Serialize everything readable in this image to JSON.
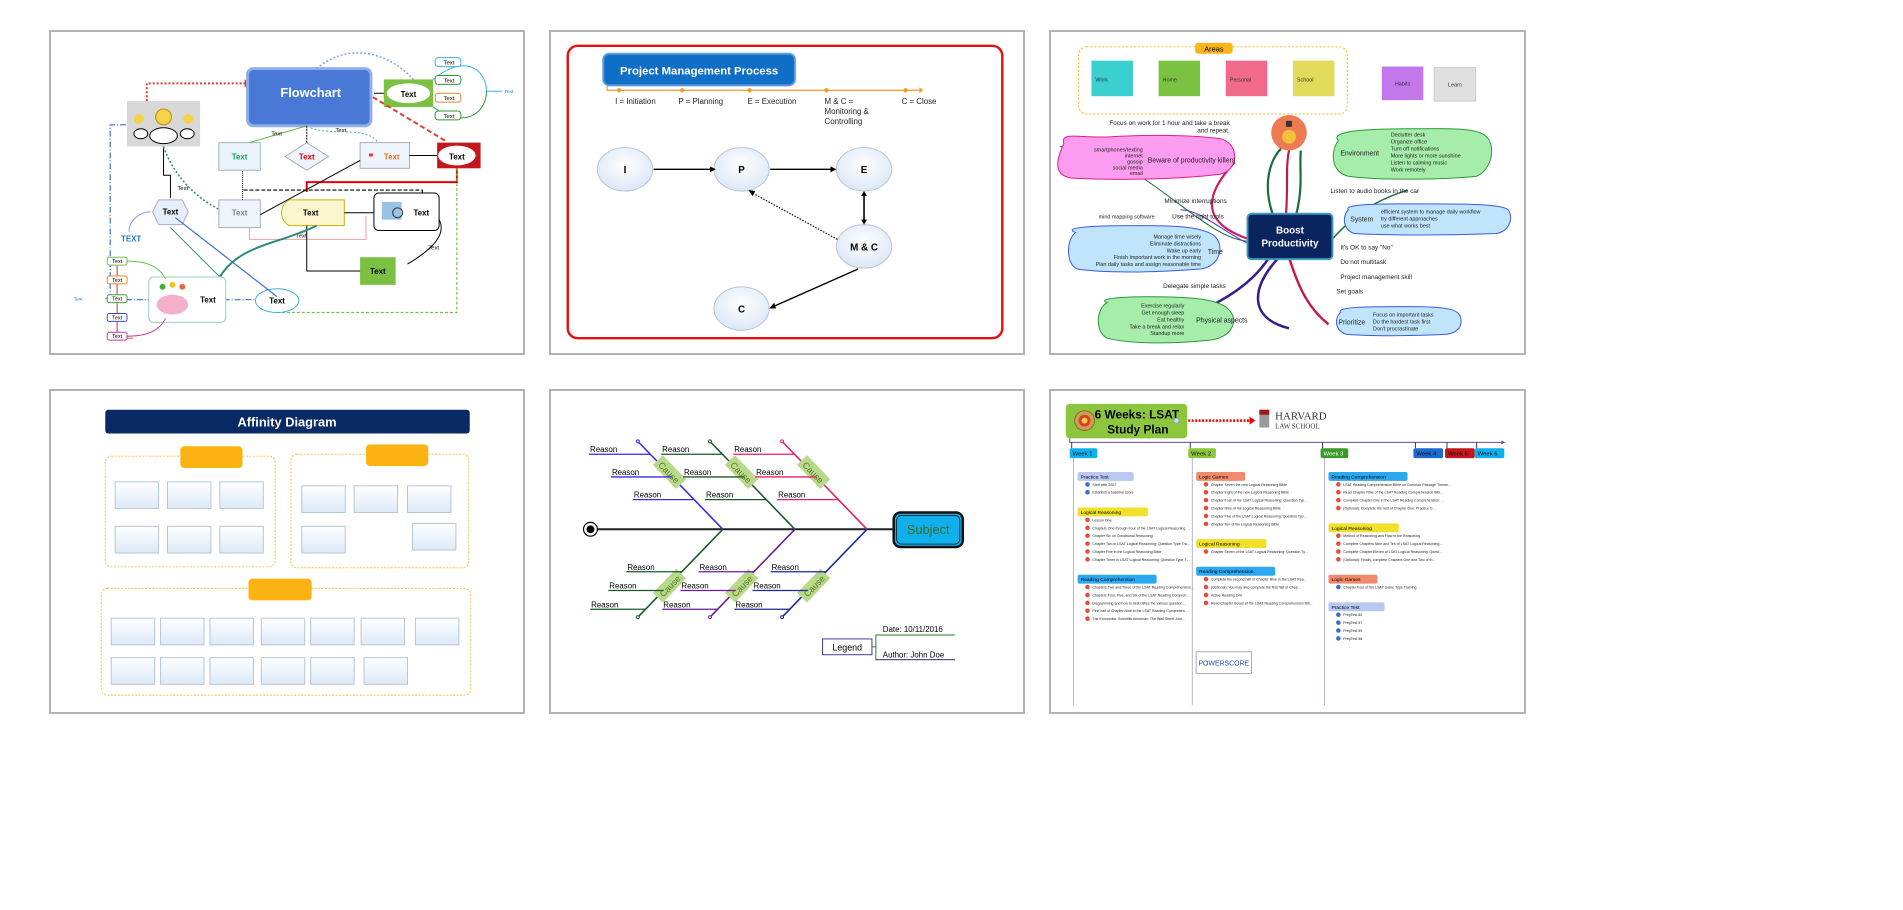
{
  "gallery": {
    "templates": [
      {
        "id": "flowchart",
        "title": "Flowchart",
        "node_label": "Text",
        "caps_label": "TEXT",
        "side_labels": [
          "Text",
          "Text",
          "Text",
          "Text",
          "Text"
        ],
        "branch_labels": [
          "Text",
          "Text",
          "Text",
          "Text"
        ],
        "branch_root": "Text"
      },
      {
        "id": "project-management",
        "title": "Project Management Process",
        "legend": [
          "I = Initiation",
          "P = Planning",
          "E = Execution",
          "M & C = Monitoring & Controlling",
          "C = Close"
        ],
        "legend_lines": {
          "mc1": "M & C =",
          "mc2": "Monitoring &",
          "mc3": "Controlling"
        },
        "nodes": [
          "I",
          "P",
          "E",
          "M & C",
          "C"
        ]
      },
      {
        "id": "boost-productivity",
        "center": "Boost Productivity",
        "center_line1": "Boost",
        "center_line2": "Productivity",
        "areas_label": "Areas",
        "areas": [
          "Work",
          "Home",
          "Personal",
          "School"
        ],
        "extra_notes": [
          "Habits",
          "Learn"
        ],
        "left_branches": [
          "Focus on work for 1 hour and take a break",
          "and repeat.",
          "Beware of productivity killers",
          "Minimize interruptions",
          "Use the right tools",
          "mind mapping software",
          "Time",
          "Delegate simple tasks",
          "Physical aspects"
        ],
        "killers": [
          "smartphones/texting",
          "internet",
          "gossip",
          "social media",
          "email"
        ],
        "time_items": [
          "Manage time wisely",
          "Eliminate distractions",
          "Wake up early",
          "Finish important work in the morning",
          "Plan daily tasks and assign reasonable time"
        ],
        "physical_items": [
          "Exercise regularly",
          "Get enough sleep",
          "Eat healthy",
          "Take a break and relax",
          "Standup more"
        ],
        "environment": "Environment",
        "environment_items": [
          "Declutter desk",
          "Organize office",
          "Turn off notifications",
          "More lights or more sunshine",
          "Listen to calming music",
          "Work remotely"
        ],
        "right_branches": [
          "Listen to audio books in the car",
          "It's OK to say \"No\"",
          "Do not multitask",
          "Project management skill",
          "Set goals"
        ],
        "system": "System",
        "system_items": [
          "efficient system to manage daily workflow",
          "try different approaches",
          "use what works best"
        ],
        "prioritize": "Prioritize",
        "prioritize_items": [
          "Focus on important tasks",
          "Do the hardest task first",
          "Don't procrastinate"
        ]
      },
      {
        "id": "affinity",
        "title": "Affinity Diagram"
      },
      {
        "id": "fishbone",
        "reason_label": "Reason",
        "cause_label": "Cause",
        "subject": "Subject",
        "legend": "Legend",
        "date": "Date:  10/11/2016",
        "author": "Author:  John Doe"
      },
      {
        "id": "lsat",
        "title_line1": "6 Weeks: LSAT",
        "title_line2": "Study Plan",
        "logo_line1": "HARVARD",
        "logo_line2": "LAW SCHOOL",
        "weeks": [
          "Week 1",
          "Week 2",
          "Week 3",
          "Week 4",
          "Week 5",
          "Week 6"
        ],
        "week1": {
          "groups": [
            {
              "name": "Practice Test",
              "items": [
                "Start with 2007",
                "Establish a baseline score"
              ]
            },
            {
              "name": "Logical Reasoning",
              "items": [
                "Lesson One",
                "Chapters One through Four of the LSAT Logical Reasoning Bible",
                "Chapter Six on Conditional Reasoning",
                "Chapter Two in LSAT Logical Reasoning: Question Type Training",
                "Chapter Five in the Logical Reasoning Bible",
                "Chapter Three in LSAT Logical Reasoning: Question Type Training"
              ]
            },
            {
              "name": "Reading Comprehension",
              "items": [
                "Chapters Two and Three of the LSAT Reading Comprehension Bible",
                "Chapters Four, Five, and Six of the LSAT Reading Comprehension Bible",
                "Diagramming and how to best utilize the various question types and answer choices",
                "First half of Chapter Nine in the LSAT Reading Comprehension: Passage Type Training",
                "The Economist, Scientific American, The Wall Street Journal or New York Times, and other economically-, legally- or scientifically-oriented texts"
              ]
            }
          ]
        },
        "week2": {
          "groups": [
            {
              "name": "Logic Games",
              "items": [
                "Chapter Seven the new Logical Reasoning Bible",
                "Chapter Eight of the new Logical Reasoning Bible",
                "Chapter Four of the LSAT Logical Reasoning: Question Type Training",
                "Chapter Nine of the Logical Reasoning Bible",
                "Chapter Five of the LSAT Logical Reasoning: Question Type Training",
                "Chapter Ten of the Logical Reasoning Bible"
              ]
            },
            {
              "name": "Logical Reasoning",
              "items": [
                "Chapter Seven of the LSAT Logical Reasoning: Question Type Training"
              ]
            },
            {
              "name": "Reading Comprehension",
              "items": [
                "Complete the second half of Chapter Nine in the LSAT Reading Comprehension: Passage Type Training",
                "(Optional): You may also complete the first half of Chapter Seven: Practice Drills in the LSAT Reading Comprehension Bible Workbook",
                "Active Reading Drill",
                "Read Chapter Seven of the LSAT Reading Comprehension Bible"
              ]
            }
          ],
          "badge": "POWERSCORE"
        },
        "week3": {
          "groups": [
            {
              "name": "Reading Comprehension",
              "items": [
                "LSAT Reading Comprehension Bible on Common Passage Themes",
                "Read Chapter Nine of the LSAT Reading Comprehension Bible",
                "Complete Chapter One in the LSAT Reading Comprehension: Passage Type Training",
                "(Optional): Complete the rest of Chapter One: Practice Drills in the LSAT Reading Comprehension Bible"
              ]
            },
            {
              "name": "Logical Reasoning",
              "items": [
                "Method of Reasoning and Flaw in the Reasoning",
                "Complete Chapters Nine and Ten of LSAT Logical Reasoning: Question Type Training",
                "Complete Chapter Eleven of LSAT Logical Reasoning: Question Type Training",
                "(Optional): Finally, complete Chapters One and Two of the LSAT Logical Reasoning Bible Workbook"
              ]
            },
            {
              "name": "Logic Games",
              "items": [
                "Chapter Four of the LSAT Game Type Training"
              ]
            },
            {
              "name": "Practice Test",
              "items": [
                "PrepTest 60",
                "PrepTest 57",
                "PrepTest 59",
                "PrepTest 58"
              ]
            }
          ]
        }
      }
    ]
  }
}
